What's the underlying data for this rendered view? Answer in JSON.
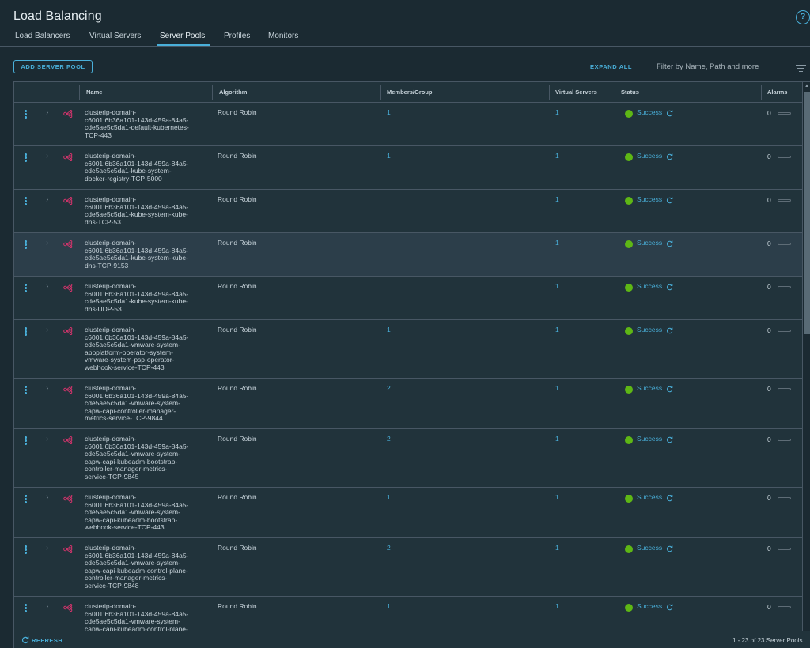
{
  "page": {
    "title": "Load Balancing"
  },
  "icons": {
    "help": "help-circle-icon",
    "filter": "filter-lines-icon",
    "row_menu": "kebab-vertical-icon",
    "row_expand": "chevron-right-icon",
    "pool": "server-pool-icon",
    "status": "refresh-icon"
  },
  "colors": {
    "accent": "#49afd9",
    "success": "#5eb715",
    "pool_icon": "#d0346b",
    "background": "#1b2a32"
  },
  "tabs": [
    {
      "label": "Load Balancers",
      "active": false
    },
    {
      "label": "Virtual Servers",
      "active": false
    },
    {
      "label": "Server Pools",
      "active": true
    },
    {
      "label": "Profiles",
      "active": false
    },
    {
      "label": "Monitors",
      "active": false
    }
  ],
  "help_label": "?",
  "toolbar": {
    "add_label": "ADD SERVER POOL",
    "expand_label": "EXPAND ALL",
    "filter_placeholder": "Filter by Name, Path and more"
  },
  "table": {
    "columns": {
      "name": "Name",
      "algorithm": "Algorithm",
      "members": "Members/Group",
      "virtual_servers": "Virtual Servers",
      "status": "Status",
      "alarms": "Alarms"
    },
    "rows": [
      {
        "name": [
          "clusterip-domain-",
          "c6001:6b36a101-143d-459a-84a5-",
          "cde5ae5c5da1-default-kubernetes-",
          "TCP-443"
        ],
        "algorithm": "Round Robin",
        "members": "1",
        "virtual_servers": "1",
        "status": "Success",
        "alarms": "0"
      },
      {
        "name": [
          "clusterip-domain-",
          "c6001:6b36a101-143d-459a-84a5-",
          "cde5ae5c5da1-kube-system-",
          "docker-registry-TCP-5000"
        ],
        "algorithm": "Round Robin",
        "members": "1",
        "virtual_servers": "1",
        "status": "Success",
        "alarms": "0"
      },
      {
        "name": [
          "clusterip-domain-",
          "c6001:6b36a101-143d-459a-84a5-",
          "cde5ae5c5da1-kube-system-kube-",
          "dns-TCP-53"
        ],
        "algorithm": "Round Robin",
        "members": "",
        "virtual_servers": "1",
        "status": "Success",
        "alarms": "0"
      },
      {
        "name": [
          "clusterip-domain-",
          "c6001:6b36a101-143d-459a-84a5-",
          "cde5ae5c5da1-kube-system-kube-",
          "dns-TCP-9153"
        ],
        "algorithm": "Round Robin",
        "members": "",
        "virtual_servers": "1",
        "status": "Success",
        "alarms": "0",
        "selected": true
      },
      {
        "name": [
          "clusterip-domain-",
          "c6001:6b36a101-143d-459a-84a5-",
          "cde5ae5c5da1-kube-system-kube-",
          "dns-UDP-53"
        ],
        "algorithm": "Round Robin",
        "members": "",
        "virtual_servers": "1",
        "status": "Success",
        "alarms": "0"
      },
      {
        "name": [
          "clusterip-domain-",
          "c6001:6b36a101-143d-459a-84a5-",
          "cde5ae5c5da1-vmware-system-",
          "appplatform-operator-system-",
          "vmware-system-psp-operator-",
          "webhook-service-TCP-443"
        ],
        "algorithm": "Round Robin",
        "members": "1",
        "virtual_servers": "1",
        "status": "Success",
        "alarms": "0"
      },
      {
        "name": [
          "clusterip-domain-",
          "c6001:6b36a101-143d-459a-84a5-",
          "cde5ae5c5da1-vmware-system-",
          "capw-capi-controller-manager-",
          "metrics-service-TCP-9844"
        ],
        "algorithm": "Round Robin",
        "members": "2",
        "virtual_servers": "1",
        "status": "Success",
        "alarms": "0"
      },
      {
        "name": [
          "clusterip-domain-",
          "c6001:6b36a101-143d-459a-84a5-",
          "cde5ae5c5da1-vmware-system-",
          "capw-capi-kubeadm-bootstrap-",
          "controller-manager-metrics-",
          "service-TCP-9845"
        ],
        "algorithm": "Round Robin",
        "members": "2",
        "virtual_servers": "1",
        "status": "Success",
        "alarms": "0"
      },
      {
        "name": [
          "clusterip-domain-",
          "c6001:6b36a101-143d-459a-84a5-",
          "cde5ae5c5da1-vmware-system-",
          "capw-capi-kubeadm-bootstrap-",
          "webhook-service-TCP-443"
        ],
        "algorithm": "Round Robin",
        "members": "1",
        "virtual_servers": "1",
        "status": "Success",
        "alarms": "0"
      },
      {
        "name": [
          "clusterip-domain-",
          "c6001:6b36a101-143d-459a-84a5-",
          "cde5ae5c5da1-vmware-system-",
          "capw-capi-kubeadm-control-plane-",
          "controller-manager-metrics-",
          "service-TCP-9848"
        ],
        "algorithm": "Round Robin",
        "members": "2",
        "virtual_servers": "1",
        "status": "Success",
        "alarms": "0"
      },
      {
        "name": [
          "clusterip-domain-",
          "c6001:6b36a101-143d-459a-84a5-",
          "cde5ae5c5da1-vmware-system-",
          "capw-capi-kubeadm-control-plane-"
        ],
        "algorithm": "Round Robin",
        "members": "1",
        "virtual_servers": "1",
        "status": "Success",
        "alarms": "0"
      }
    ]
  },
  "footer": {
    "refresh_label": "REFRESH",
    "pagination": "1 - 23 of 23 Server Pools"
  }
}
